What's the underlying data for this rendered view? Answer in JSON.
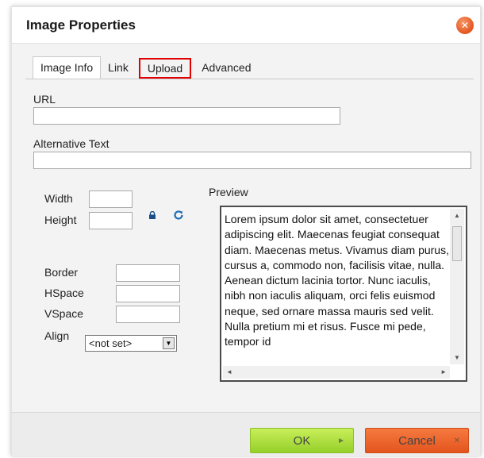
{
  "dialog": {
    "title": "Image Properties",
    "close_icon": "close-icon",
    "close_glyph": "✕"
  },
  "tabs": [
    {
      "label": "Image Info",
      "active": true
    },
    {
      "label": "Link",
      "active": false
    },
    {
      "label": "Upload",
      "active": false,
      "highlighted": true
    },
    {
      "label": "Advanced",
      "active": false
    }
  ],
  "form": {
    "url_label": "URL",
    "url_value": "",
    "alt_label": "Alternative Text",
    "alt_value": "",
    "width_label": "Width",
    "width_value": "",
    "height_label": "Height",
    "height_value": "",
    "lock_icon": "lock-icon",
    "reset_icon": "reset-size-icon",
    "border_label": "Border",
    "border_value": "",
    "hspace_label": "HSpace",
    "hspace_value": "",
    "vspace_label": "VSpace",
    "vspace_value": "",
    "align_label": "Align",
    "align_selected": "<not set>"
  },
  "preview": {
    "label": "Preview",
    "text": "Lorem ipsum dolor sit amet, consectetuer adipiscing elit. Maecenas feugiat consequat diam. Maecenas metus. Vivamus diam purus, cursus a, commodo non, facilisis vitae, nulla. Aenean dictum lacinia tortor. Nunc iaculis, nibh non iaculis aliquam, orci felis euismod neque, sed ornare massa mauris sed velit. Nulla pretium mi et risus. Fusce mi pede, tempor id"
  },
  "footer": {
    "ok_label": "OK",
    "ok_icon": "►",
    "cancel_label": "Cancel",
    "cancel_icon": "✕"
  },
  "colors": {
    "ok_button": "#a6dc35",
    "cancel_button": "#ec6428",
    "upload_tab_highlight": "#e10000"
  }
}
